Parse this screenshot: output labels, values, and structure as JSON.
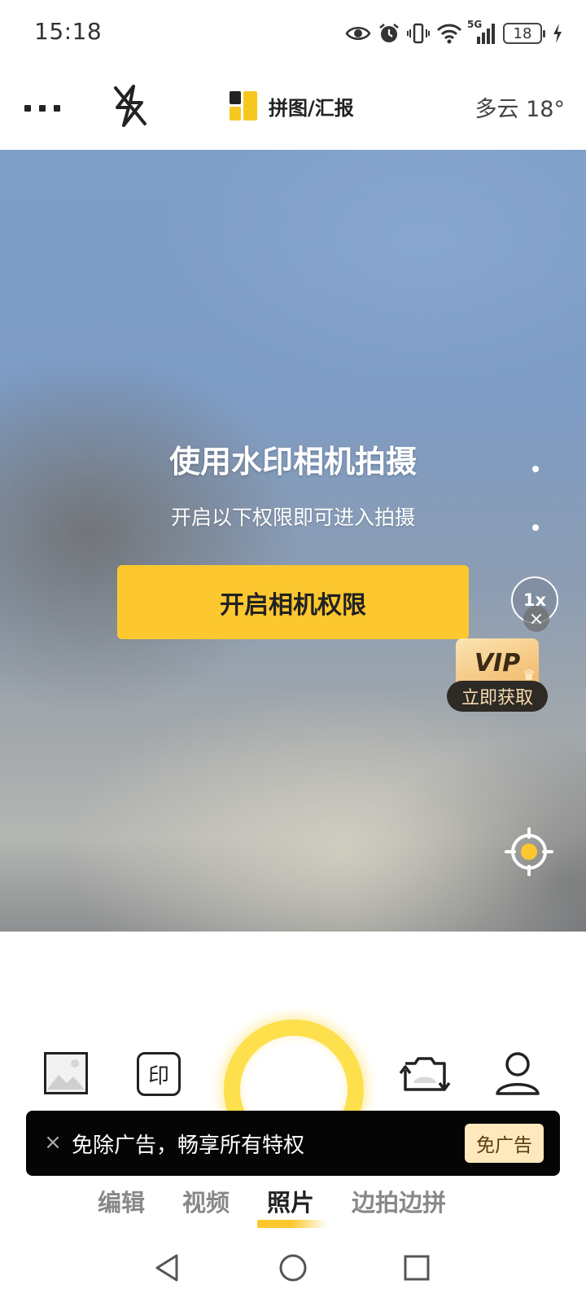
{
  "status_bar": {
    "time": "15:18",
    "network": "5G",
    "battery_level": "18",
    "icons": [
      "eye-icon",
      "alarm-icon",
      "vibrate-icon",
      "wifi-icon",
      "signal-icon",
      "battery-icon",
      "charging-icon"
    ]
  },
  "toolbar": {
    "more_icon": "more-dots-icon",
    "flash_icon": "flash-off-icon",
    "collage_label": "拼图/汇报",
    "weather": "多云 18°"
  },
  "viewport": {
    "title": "使用水印相机拍摄",
    "subtitle": "开启以下权限即可进入拍摄",
    "permission_button": "开启相机权限",
    "zoom": "1x",
    "vip_badge": "VIP",
    "vip_button": "立即获取",
    "locate_icon": "locate-icon"
  },
  "controls": {
    "gallery_icon": "gallery-icon",
    "watermark_label": "印",
    "flip_icon": "camera-flip-icon",
    "profile_icon": "profile-icon"
  },
  "ad": {
    "text": "免除广告，畅享所有特权",
    "button": "免广告"
  },
  "modes": [
    {
      "label": "编辑",
      "active": false
    },
    {
      "label": "视频",
      "active": false
    },
    {
      "label": "照片",
      "active": true
    },
    {
      "label": "边拍边拼",
      "active": false
    }
  ],
  "navbar": [
    "back-icon",
    "home-icon",
    "recents-icon"
  ],
  "colors": {
    "accent": "#fdc82f",
    "shutter": "#fde04c",
    "ad_background": "#050505",
    "ad_button": "#fde9bd"
  }
}
